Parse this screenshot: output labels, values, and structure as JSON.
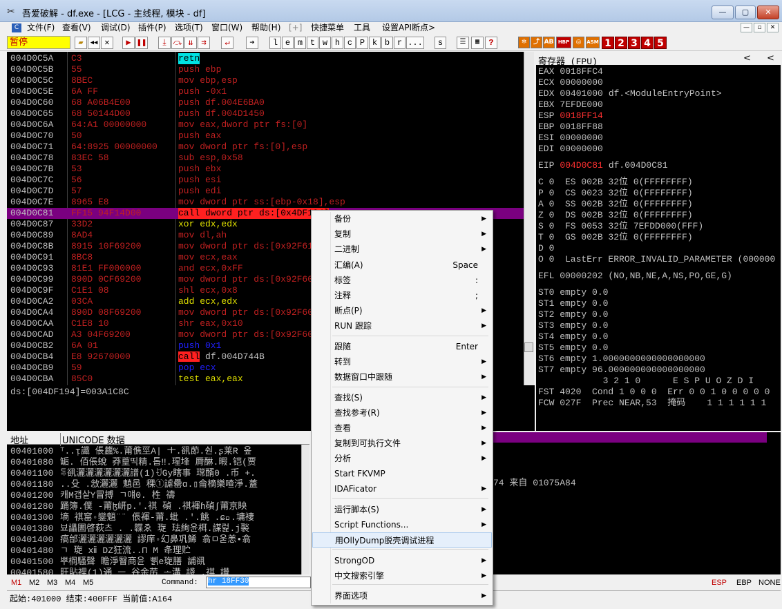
{
  "title": "吾爱破解 - df.exe - [LCG - 主线程, 模块 - df]",
  "window_buttons": [
    "—",
    "▢",
    "✕"
  ],
  "menu": [
    "文件(F)",
    "查看(V)",
    "调试(D)",
    "插件(P)",
    "选项(T)",
    "窗口(W)",
    "帮助(H)",
    "[+]",
    "快捷菜单",
    "工具",
    "设置API断点>"
  ],
  "mdi_buttons": [
    "—",
    "▫",
    "✕"
  ],
  "status": "暂停",
  "toolbar_letters": [
    "l",
    "e",
    "m",
    "t",
    "w",
    "h",
    "c",
    "P",
    "k",
    "b",
    "r",
    "...",
    "s"
  ],
  "toolbar_numbers": [
    "1",
    "2",
    "3",
    "4",
    "5"
  ],
  "toolbar_badges": [
    "HBP",
    "ASM"
  ],
  "disasm": [
    {
      "addr": "004D0C5A",
      "hex": "C3",
      "asm": "retn"
    },
    {
      "addr": "004D0C5B",
      "hex": "55",
      "asm": "push ebp"
    },
    {
      "addr": "004D0C5C",
      "hex": "8BEC",
      "asm": "mov ebp,esp"
    },
    {
      "addr": "004D0C5E",
      "hex": "6A FF",
      "asm": "push -0x1"
    },
    {
      "addr": "004D0C60",
      "hex": "68 A06B4E00",
      "asm": "push df.004E6BA0"
    },
    {
      "addr": "004D0C65",
      "hex": "68 50144D00",
      "asm": "push df.004D1450"
    },
    {
      "addr": "004D0C6A",
      "hex": "64:A1 00000000",
      "asm": "mov eax,dword ptr fs:[0]"
    },
    {
      "addr": "004D0C70",
      "hex": "50",
      "asm": "push eax"
    },
    {
      "addr": "004D0C71",
      "hex": "64:8925 00000000",
      "asm": "mov dword ptr fs:[0],esp"
    },
    {
      "addr": "004D0C78",
      "hex": "83EC 58",
      "asm": "sub esp,0x58"
    },
    {
      "addr": "004D0C7B",
      "hex": "53",
      "asm": "push ebx"
    },
    {
      "addr": "004D0C7C",
      "hex": "56",
      "asm": "push esi"
    },
    {
      "addr": "004D0C7D",
      "hex": "57",
      "asm": "push edi"
    },
    {
      "addr": "004D0C7E",
      "hex": "8965 E8",
      "asm": "mov dword ptr ss:[ebp-0x18],esp"
    },
    {
      "addr": "004D0C81",
      "hex": "FF15 94F14D00",
      "asm": "call dword ptr ds:[0x4DF194]"
    },
    {
      "addr": "004D0C87",
      "hex": "33D2",
      "asm": "xor edx,edx"
    },
    {
      "addr": "004D0C89",
      "hex": "8AD4",
      "asm": "mov dl,ah"
    },
    {
      "addr": "004D0C8B",
      "hex": "8915 10F69200",
      "asm": "mov dword ptr ds:[0x92F610],edx"
    },
    {
      "addr": "004D0C91",
      "hex": "8BC8",
      "asm": "mov ecx,eax"
    },
    {
      "addr": "004D0C93",
      "hex": "81E1 FF000000",
      "asm": "and ecx,0xFF"
    },
    {
      "addr": "004D0C99",
      "hex": "890D 0CF69200",
      "asm": "mov dword ptr ds:[0x92F60C],ecx"
    },
    {
      "addr": "004D0C9F",
      "hex": "C1E1 08",
      "asm": "shl ecx,0x8"
    },
    {
      "addr": "004D0CA2",
      "hex": "03CA",
      "asm": "add ecx,edx"
    },
    {
      "addr": "004D0CA4",
      "hex": "890D 08F69200",
      "asm": "mov dword ptr ds:[0x92F608],ecx"
    },
    {
      "addr": "004D0CAA",
      "hex": "C1E8 10",
      "asm": "shr eax,0x10"
    },
    {
      "addr": "004D0CAD",
      "hex": "A3 04F69200",
      "asm": "mov dword ptr ds:[0x92F604],eax"
    },
    {
      "addr": "004D0CB2",
      "hex": "6A 01",
      "asm": "push 0x1"
    },
    {
      "addr": "004D0CB4",
      "hex": "E8 92670000",
      "asm": "call df.004D744B"
    },
    {
      "addr": "004D0CB9",
      "hex": "59",
      "asm": "pop ecx"
    },
    {
      "addr": "004D0CBA",
      "hex": "85C0",
      "asm": "test eax,eax"
    }
  ],
  "info_line": "ds:[004DF194]=003A1C8C",
  "registers_title": "寄存器 (FPU)",
  "registers_nav": [
    "<",
    "<"
  ],
  "registers": [
    {
      "name": "EAX",
      "value": "0018FFC4",
      "comment": ""
    },
    {
      "name": "ECX",
      "value": "00000000",
      "comment": ""
    },
    {
      "name": "EDX",
      "value": "00401000",
      "comment": "df.<ModuleEntryPoint>"
    },
    {
      "name": "EBX",
      "value": "7EFDE000",
      "comment": ""
    },
    {
      "name": "ESP",
      "value": "0018FF14",
      "comment": ""
    },
    {
      "name": "EBP",
      "value": "0018FF88",
      "comment": ""
    },
    {
      "name": "ESI",
      "value": "00000000",
      "comment": ""
    },
    {
      "name": "EDI",
      "value": "00000000",
      "comment": ""
    }
  ],
  "eip": {
    "name": "EIP",
    "value": "004D0C81",
    "comment": "df.004D0C81"
  },
  "segments": [
    "C 0  ES 002B 32位 0(FFFFFFFF)",
    "P 0  CS 0023 32位 0(FFFFFFFF)",
    "A 0  SS 002B 32位 0(FFFFFFFF)",
    "Z 0  DS 002B 32位 0(FFFFFFFF)",
    "S 0  FS 0053 32位 7EFDD000(FFF)",
    "T 0  GS 002B 32位 0(FFFFFFFF)",
    "D 0",
    "O 0  LastErr ERROR_INVALID_PARAMETER (000000"
  ],
  "efl": "EFL 00000202 (NO,NB,NE,A,NS,PO,GE,G)",
  "fpu": [
    "ST0 empty 0.0",
    "ST1 empty 0.0",
    "ST2 empty 0.0",
    "ST3 empty 0.0",
    "ST4 empty 0.0",
    "ST5 empty 0.0",
    "ST6 empty 1.0000000000000000000",
    "ST7 empty 96.000000000000000000"
  ],
  "fpu_status": [
    "            3 2 1 0      E S P U O Z D I",
    "FST 4020  Cond 1 0 0 0  Err 0 0 1 0 0 0 0 0",
    "FCW 027F  Prec NEAR,53  掩码    1 1 1 1 1 1"
  ],
  "memory_header": {
    "addr": "地址",
    "data": "UNICODE 数据"
  },
  "memory": [
    {
      "addr": "00401000",
      "text": "⸆..ᴉ讖 倀蠿%.莆僬巠A|  ㆺ.谻莭.숸.ʂ莱R  옾"
    },
    {
      "addr": "00401080",
      "text": "缿.  佰倀蛻  莽葟띡精.톱‼.瑆埄  脣醂.暇.铠(贾"
    },
    {
      "addr": "00401100",
      "text": "ꁃ谻灑灑灑灑灑灑譜(1)ꀀGy瞎事  瑺醑0  .币  +."
    },
    {
      "addr": "00401180",
      "text": "..殳 .敜灑灑   魈邑   稞①謔罍ɑ.▯侖樀樂喳淨.蓋"
    },
    {
      "addr": "00401200",
      "text": "캐M갭샅Y冒搏  ㄱ얘0.       栍         禱"
    },
    {
      "addr": "00401280",
      "text": "踊簿.僕  -莆ɮ岍p.'.祺  碵  .祺褌ɦ碵ʃ莆京眏"
    },
    {
      "addr": "00401300",
      "text": "墒  祺窰◦鑾魈¨¨ 倀褌-莆.蚍  .'.餆   .ɕ⃝.墉褄"
    },
    {
      "addr": "00401380",
      "text": "뵤讄圕啓萩츠 .       .韘ゑ   琁  珐絢윤栮.謀럹.j褧"
    },
    {
      "addr": "00401400",
      "text": "瘑邰灑灑灑灑灑灑  謬庠◦幻鼻巩鯑  翕ㅁ욷恙•翕"
    },
    {
      "addr": "00401480",
      "text": "ㄱ  琁     ⅻ     DZ狂流..⊓   M   夅理贮"
    },
    {
      "addr": "00401500",
      "text": "뿌棡騷聲   瞻淨瞖商윤     뻵e琁膳   誧谻"
    },
    {
      "addr": "00401580",
      "text": "旺貼裡(1)通     ᅳ  谷余苈     ᅩ溝  諓  .祺   讃"
    }
  ],
  "stack_text": "74 来自 01075A84",
  "bottom_tabs": [
    "M1",
    "M2",
    "M3",
    "M4",
    "M5"
  ],
  "command_label": "Command:",
  "command_value": "hr 18FF30",
  "bottom_regs": [
    "ESP",
    "EBP",
    "NONE"
  ],
  "status_line": "起始:401000 结束:400FFF 当前值:A164",
  "context_menu": [
    {
      "label": "备份",
      "shortcut": "",
      "submenu": true
    },
    {
      "label": "复制",
      "shortcut": "",
      "submenu": true
    },
    {
      "label": "二进制",
      "shortcut": "",
      "submenu": true
    },
    {
      "label": "汇编(A)",
      "shortcut": "Space",
      "submenu": false
    },
    {
      "label": "标签",
      "shortcut": ":",
      "submenu": false
    },
    {
      "label": "注释",
      "shortcut": ";",
      "submenu": false
    },
    {
      "label": "断点(P)",
      "shortcut": "",
      "submenu": true
    },
    {
      "label": "RUN 跟踪",
      "shortcut": "",
      "submenu": true
    },
    {
      "label": "跟随",
      "shortcut": "Enter",
      "submenu": false
    },
    {
      "label": "转到",
      "shortcut": "",
      "submenu": true
    },
    {
      "label": "数据窗口中跟随",
      "shortcut": "",
      "submenu": true
    },
    {
      "label": "查找(S)",
      "shortcut": "",
      "submenu": true
    },
    {
      "label": "查找参考(R)",
      "shortcut": "",
      "submenu": true
    },
    {
      "label": "查看",
      "shortcut": "",
      "submenu": true
    },
    {
      "label": "复制到可执行文件",
      "shortcut": "",
      "submenu": true
    },
    {
      "label": "分析",
      "shortcut": "",
      "submenu": true
    },
    {
      "label": "Start FKVMP",
      "shortcut": "",
      "submenu": false
    },
    {
      "label": "IDAFicator",
      "shortcut": "",
      "submenu": true
    },
    {
      "label": "运行脚本(S)",
      "shortcut": "",
      "submenu": true
    },
    {
      "label": "Script Functions...",
      "shortcut": "",
      "submenu": true
    },
    {
      "label": "用OllyDump脱壳调试进程",
      "shortcut": "",
      "submenu": false
    },
    {
      "label": "StrongOD",
      "shortcut": "",
      "submenu": true
    },
    {
      "label": "中文搜索引擎",
      "shortcut": "",
      "submenu": true
    },
    {
      "label": "界面选项",
      "shortcut": "",
      "submenu": true
    }
  ],
  "colors": {
    "selection": "#7a0080",
    "code_red": "#c02020",
    "text_gray": "#c0c0c0",
    "status_yellow": "#ffff00"
  }
}
